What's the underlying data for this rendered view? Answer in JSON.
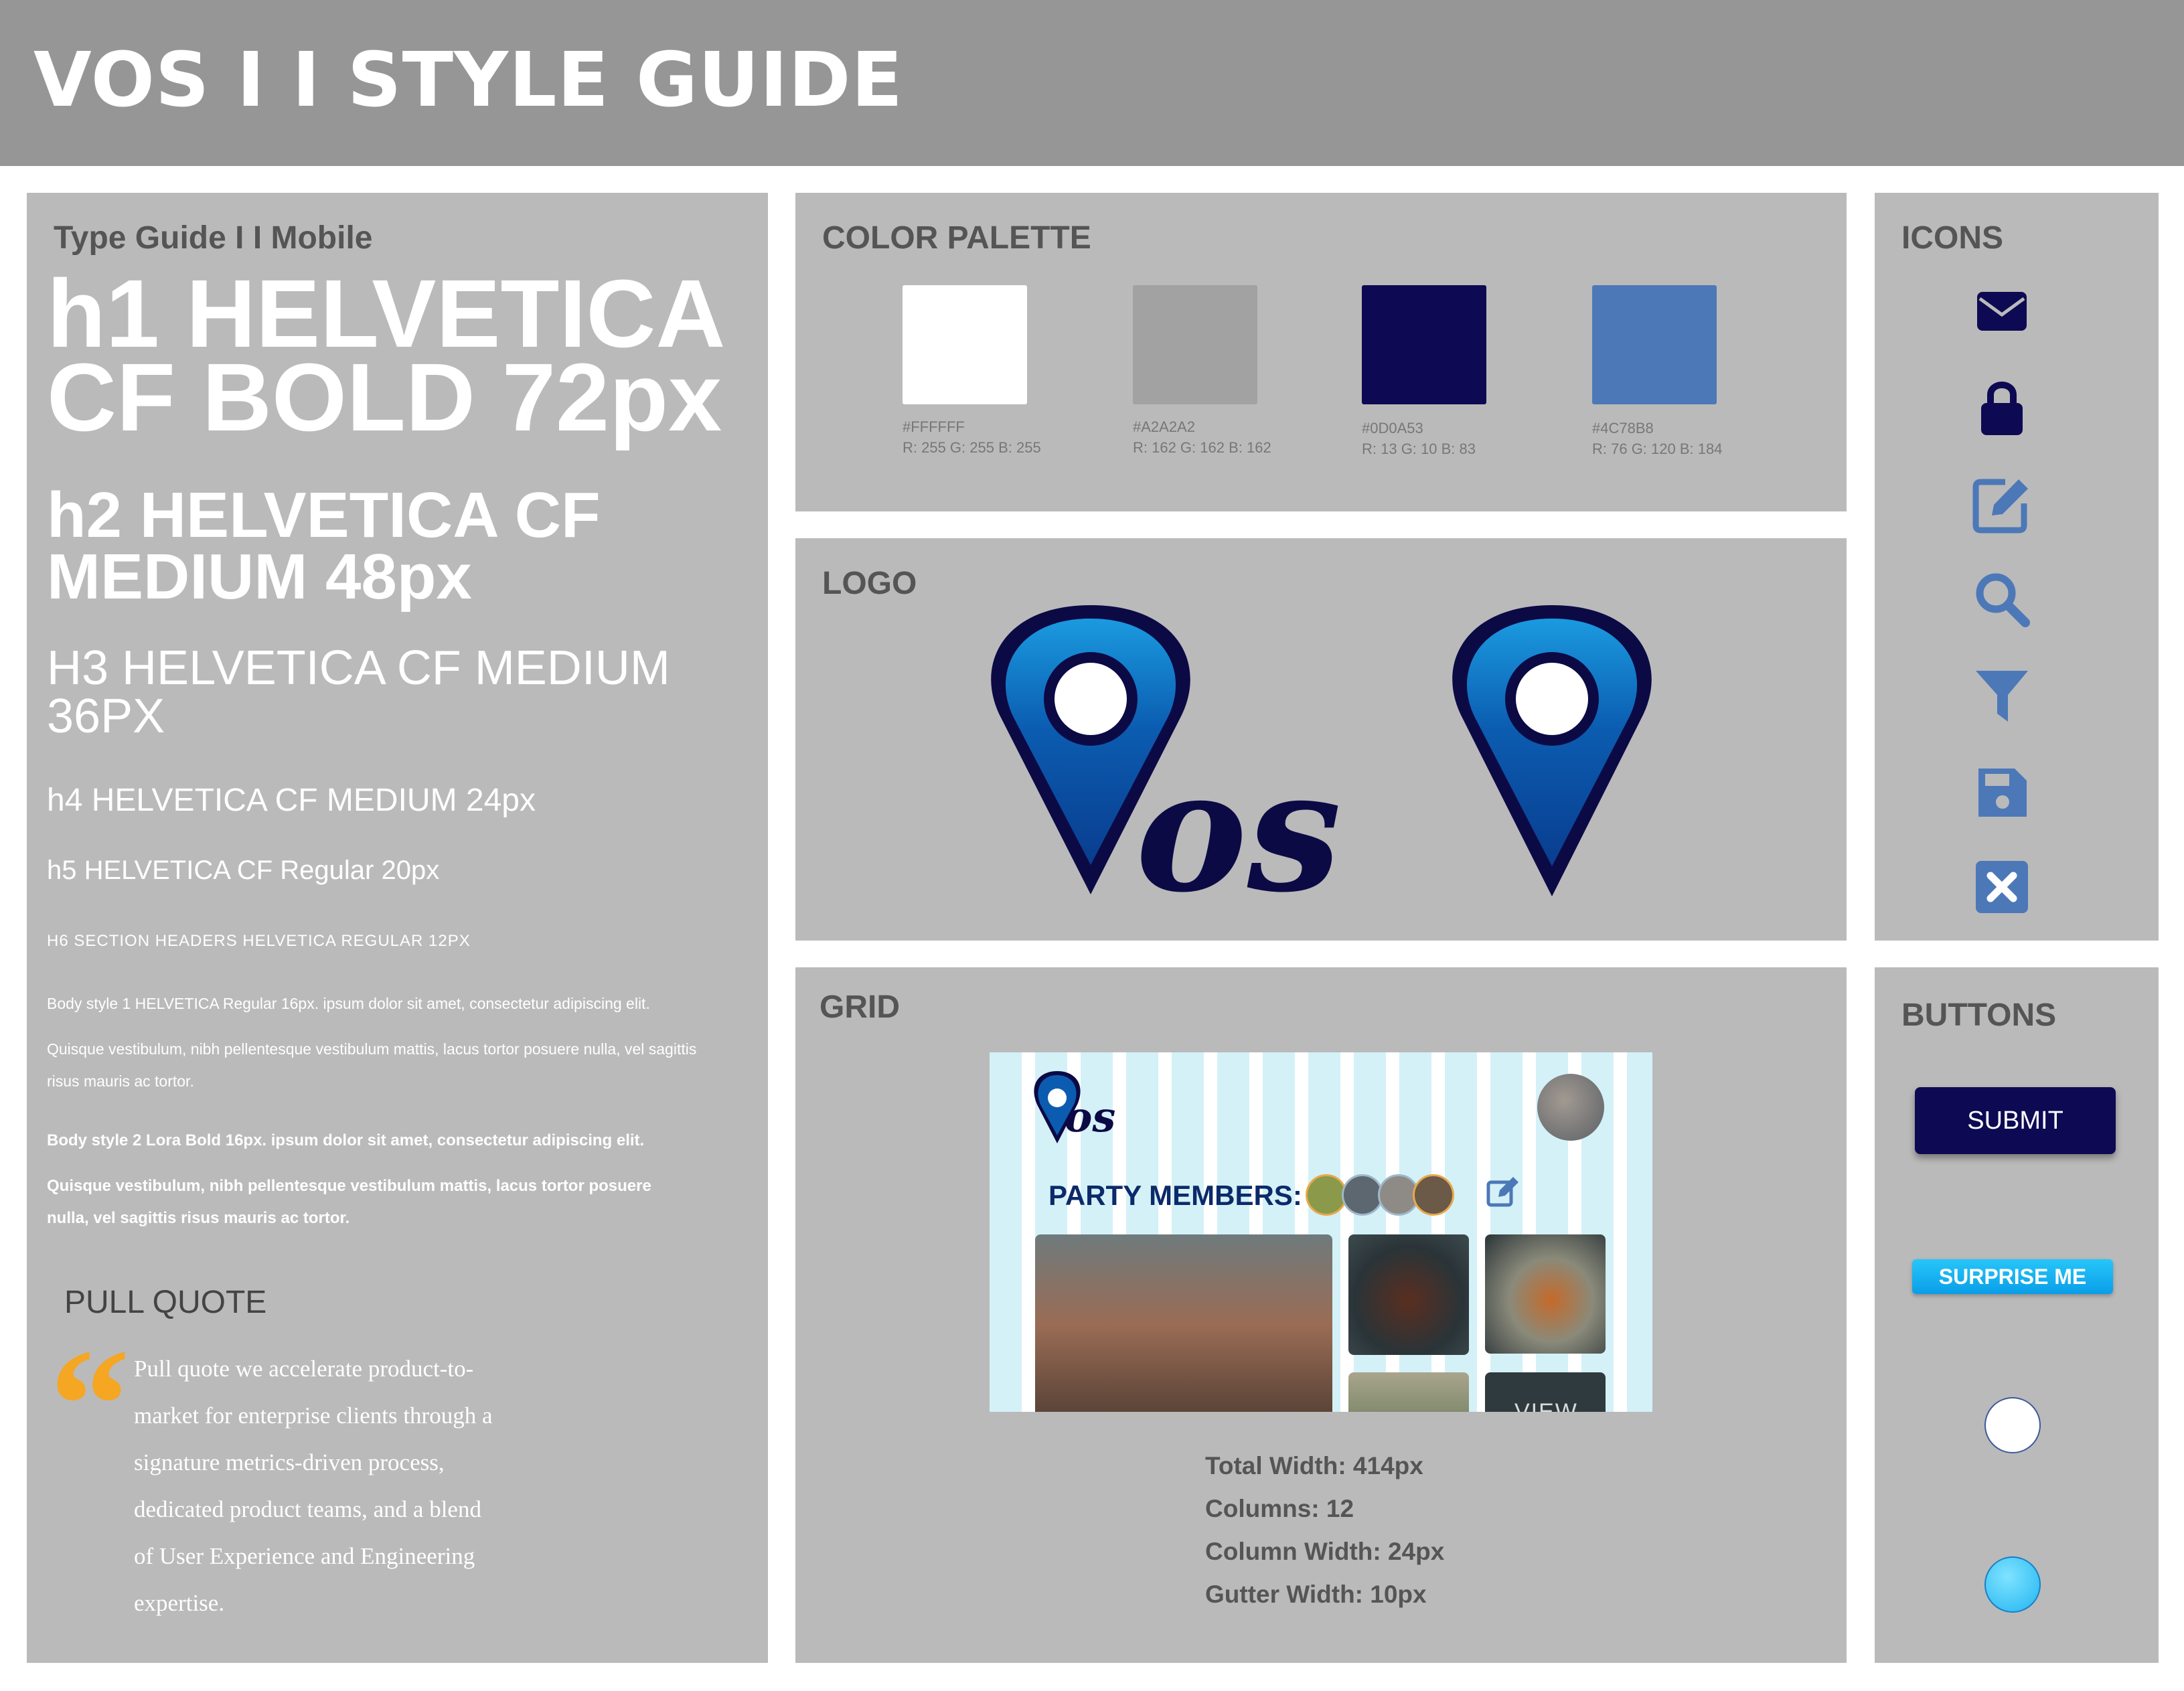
{
  "header": {
    "title": "VOS  I I STYLE GUIDE"
  },
  "type_guide": {
    "title": "Type Guide  I I  Mobile",
    "h1": [
      "h1 HELVETICA",
      "CF BOLD 72px"
    ],
    "h2": [
      "h2 HELVETICA CF",
      "MEDIUM 48px"
    ],
    "h3": [
      "H3 HELVETICA CF MEDIUM",
      "36PX"
    ],
    "h4": "h4 HELVETICA CF MEDIUM 24px",
    "h5": "h5 HELVETICA CF Regular 20px",
    "h6": "H6 SECTION HEADERS HELVETICA REGULAR 12PX",
    "body1": [
      "Body style 1 HELVETICA Regular 16px. ipsum dolor sit amet, consectetur adipiscing elit.",
      "Quisque vestibulum, nibh pellentesque vestibulum mattis, lacus tortor posuere nulla, vel sagittis",
      "risus mauris ac tortor."
    ],
    "body2": [
      "Body style 2 Lora Bold 16px. ipsum dolor sit amet, consectetur adipiscing elit.",
      "Quisque vestibulum, nibh pellentesque vestibulum mattis, lacus tortor posuere",
      "nulla, vel sagittis risus mauris ac tortor."
    ],
    "pull_quote_title": "PULL QUOTE",
    "pull_quote_mark": "“",
    "pull_quote": [
      "Pull quote we accelerate product-to-",
      "market for enterprise clients through a",
      "signature metrics-driven process,",
      "dedicated product teams, and a blend",
      "of User Experience and Engineering",
      "expertise."
    ]
  },
  "color_palette": {
    "title": "COLOR PALETTE",
    "swatches": [
      {
        "hex": "#FFFFFF",
        "rgb": "R: 255 G: 255 B: 255",
        "color": "#ffffff"
      },
      {
        "hex": "#A2A2A2",
        "rgb": "R: 162 G: 162 B: 162",
        "color": "#a2a2a2"
      },
      {
        "hex": "#0D0A53",
        "rgb": "R: 13 G: 10 B: 83",
        "color": "#0d0a53"
      },
      {
        "hex": "#4C78B8",
        "rgb": "R: 76 G: 120 B: 184",
        "color": "#4c78b8"
      }
    ]
  },
  "logo": {
    "title": "LOGO",
    "wordmark": "os"
  },
  "grid": {
    "title": "GRID",
    "mock": {
      "wordmark": "os",
      "party_label": "PARTY MEMBERS:",
      "view_label": "VIEW"
    },
    "stats": [
      "Total Width: 414px",
      "Columns: 12",
      "Column Width: 24px",
      "Gutter Width: 10px"
    ]
  },
  "icons": {
    "title": "ICONS",
    "items": [
      "envelope-icon",
      "lock-icon",
      "edit-icon",
      "search-icon",
      "filter-icon",
      "save-icon",
      "close-icon"
    ]
  },
  "buttons": {
    "title": "BUTTONS",
    "submit": "SUBMIT",
    "surprise": "SURPRISE ME"
  }
}
